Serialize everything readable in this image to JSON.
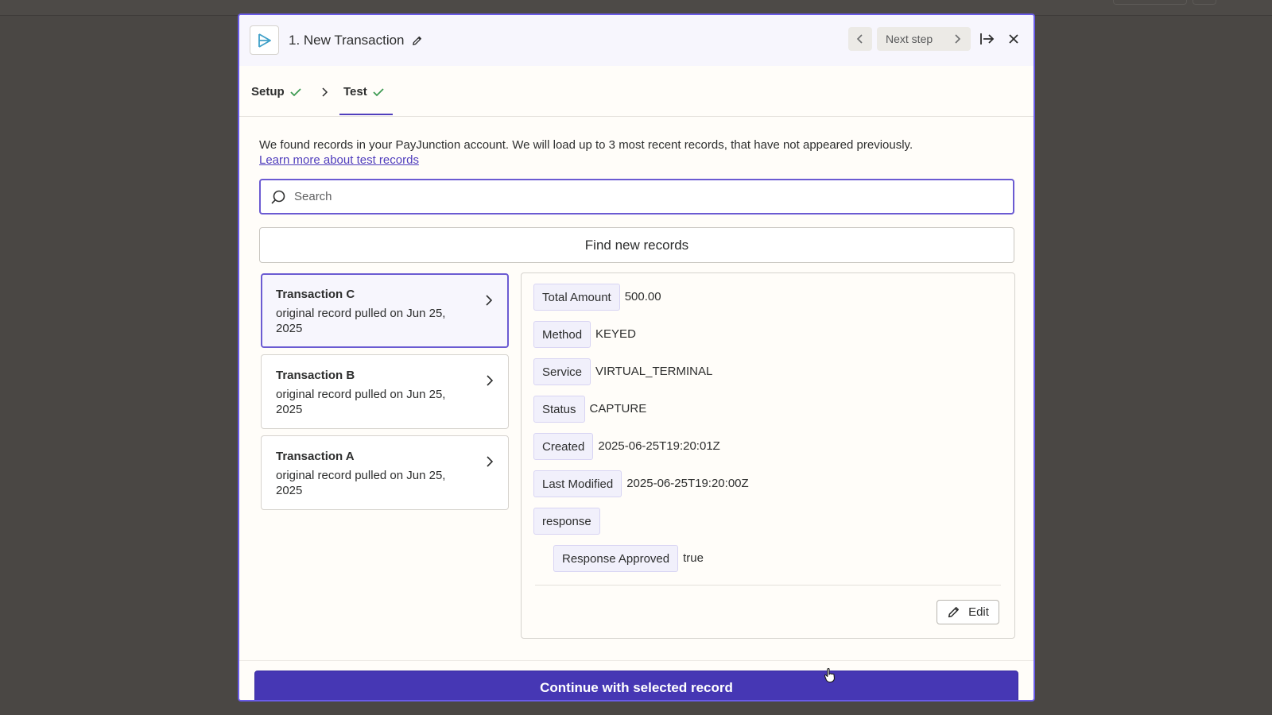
{
  "header": {
    "title": "1. New Transaction",
    "prev_icon": "chevron-left-icon",
    "next_label": "Next step",
    "expand_icon": "expand-icon",
    "close_icon": "close-icon"
  },
  "tabs": [
    {
      "label": "Setup",
      "complete": true
    },
    {
      "label": "Test",
      "complete": true,
      "active": true
    }
  ],
  "intro": {
    "text": "We found records in your PayJunction account. We will load up to 3 most recent records, that have not appeared previously.",
    "link": "Learn more about test records"
  },
  "search": {
    "placeholder": "Search",
    "value": ""
  },
  "find_button": "Find new records",
  "records": [
    {
      "title": "Transaction C",
      "desc": "original record pulled on Jun 25, 2025",
      "selected": true
    },
    {
      "title": "Transaction B",
      "desc": "original record pulled on Jun 25, 2025",
      "selected": false
    },
    {
      "title": "Transaction A",
      "desc": "original record pulled on Jun 25, 2025",
      "selected": false
    }
  ],
  "detail": {
    "fields": [
      {
        "key": "Total Amount",
        "value": "500.00"
      },
      {
        "key": "Method",
        "value": "KEYED"
      },
      {
        "key": "Service",
        "value": "VIRTUAL_TERMINAL"
      },
      {
        "key": "Status",
        "value": "CAPTURE"
      },
      {
        "key": "Created",
        "value": "2025-06-25T19:20:01Z"
      },
      {
        "key": "Last Modified",
        "value": "2025-06-25T19:20:00Z"
      },
      {
        "key": "response",
        "value": ""
      }
    ],
    "nested": [
      {
        "key": "Response Approved",
        "value": "true"
      }
    ],
    "edit_label": "Edit"
  },
  "continue_button": "Continue with selected record",
  "colors": {
    "accent": "#503ebd",
    "primary_button": "#4637b4",
    "check": "#3d9a52",
    "overlay": "#4a4744"
  }
}
